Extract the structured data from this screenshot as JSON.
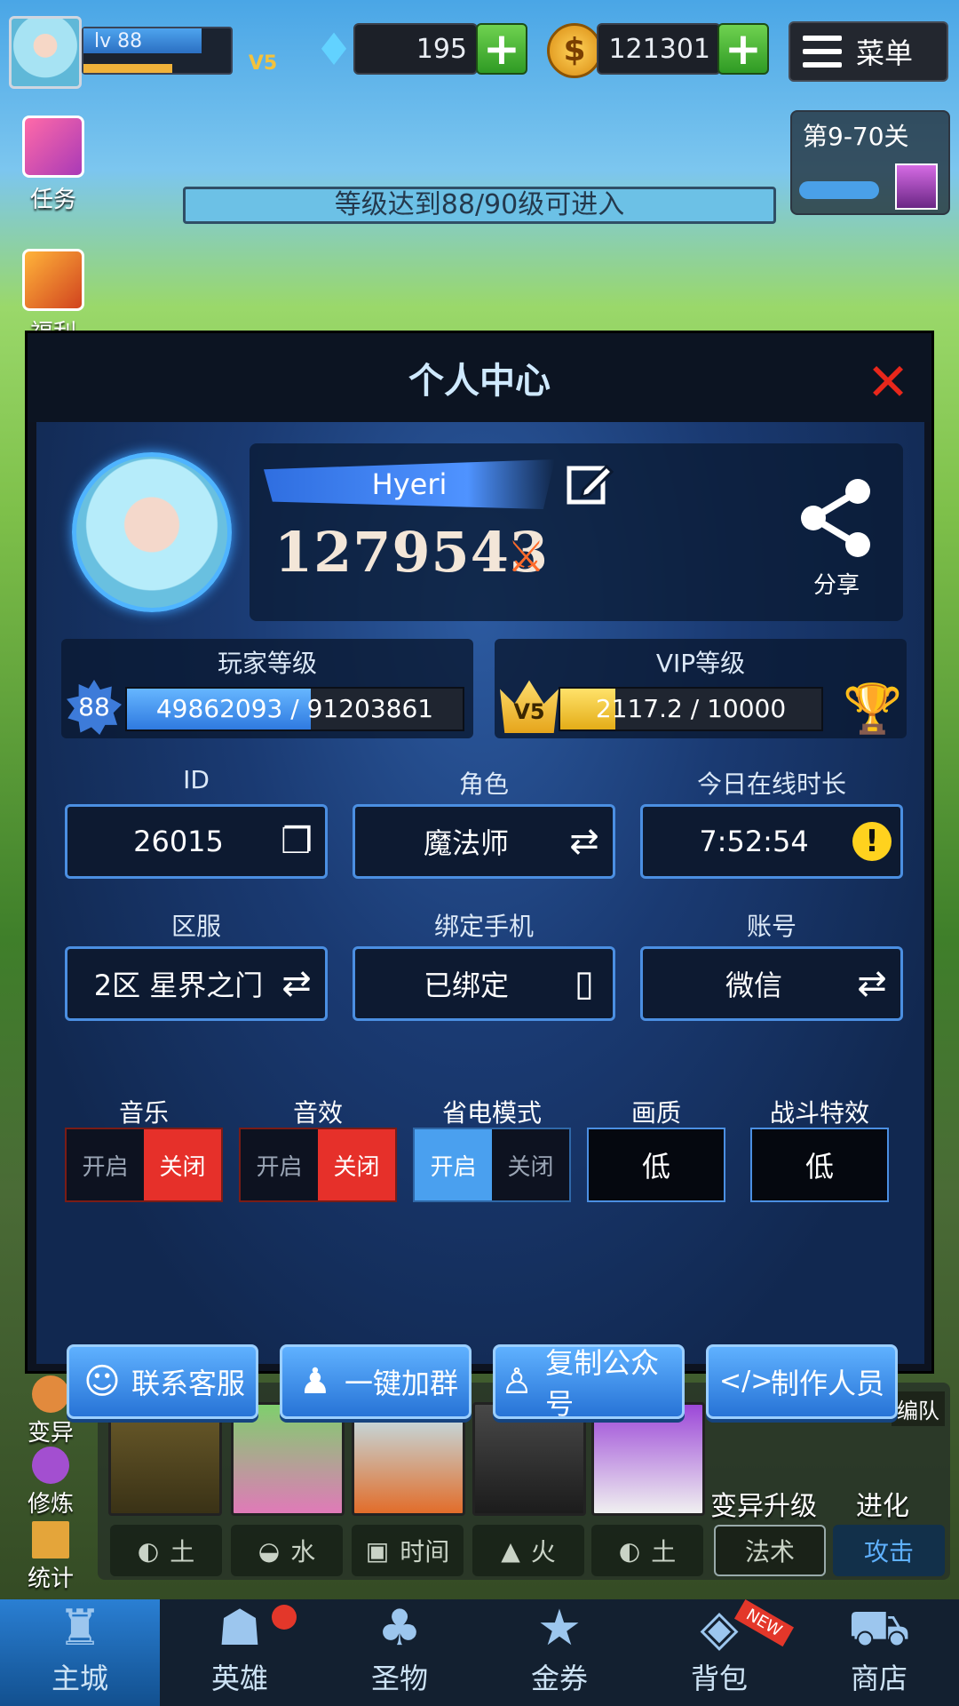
{
  "hud": {
    "level_label": "lv 88",
    "vip_label": "V5",
    "diamonds": "195",
    "gold": "121301",
    "menu_label": "菜单",
    "task_label": "任务",
    "welfare_label": "福利",
    "stage_label": "第9-70关",
    "notice": "等级达到88/90级可进入"
  },
  "panel": {
    "title": "个人中心",
    "player_name": "Hyeri",
    "combat_power": "1279543",
    "share_label": "分享",
    "player_level": {
      "label": "玩家等级",
      "badge": "88",
      "progress_text": "49862093 / 91203861",
      "progress": 0.547
    },
    "vip_level": {
      "label": "VIP等级",
      "badge": "V5",
      "progress_text": "2117.2 / 10000",
      "progress": 0.212
    },
    "fields": [
      {
        "label": "ID",
        "value": "26015",
        "icon": "copy-icon"
      },
      {
        "label": "角色",
        "value": "魔法师",
        "icon": "swap-icon"
      },
      {
        "label": "今日在线时长",
        "value": "7:52:54",
        "icon": "alert-icon"
      },
      {
        "label": "区服",
        "value": "2区 星界之门",
        "icon": "swap-icon"
      },
      {
        "label": "绑定手机",
        "value": "已绑定",
        "icon": "phone-icon"
      },
      {
        "label": "账号",
        "value": "微信",
        "icon": "swap-icon"
      }
    ],
    "toggles": [
      {
        "label": "音乐",
        "on": "开启",
        "off": "关闭",
        "state": "off"
      },
      {
        "label": "音效",
        "on": "开启",
        "off": "关闭",
        "state": "off"
      },
      {
        "label": "省电模式",
        "on": "开启",
        "off": "关闭",
        "state": "on"
      }
    ],
    "selects": [
      {
        "label": "画质",
        "value": "低"
      },
      {
        "label": "战斗特效",
        "value": "低"
      }
    ],
    "actions": [
      "联系客服",
      "一键加群",
      "复制公众号",
      "制作人员"
    ]
  },
  "bottom": {
    "left": [
      "变异",
      "修炼",
      "统计"
    ],
    "team_label": "编队",
    "mutate_upgrade": "变异升级",
    "evolve": "进化",
    "elements": [
      "土",
      "水",
      "时间",
      "火",
      "土"
    ],
    "spell_label": "法术",
    "attack_label": "攻击",
    "tabs": [
      "主城",
      "英雄",
      "圣物",
      "金券",
      "背包",
      "商店"
    ],
    "new_badge": "NEW"
  },
  "colors": {
    "accent": "#4aa0ef",
    "danger": "#e6302a",
    "gold": "#f4c23d"
  }
}
